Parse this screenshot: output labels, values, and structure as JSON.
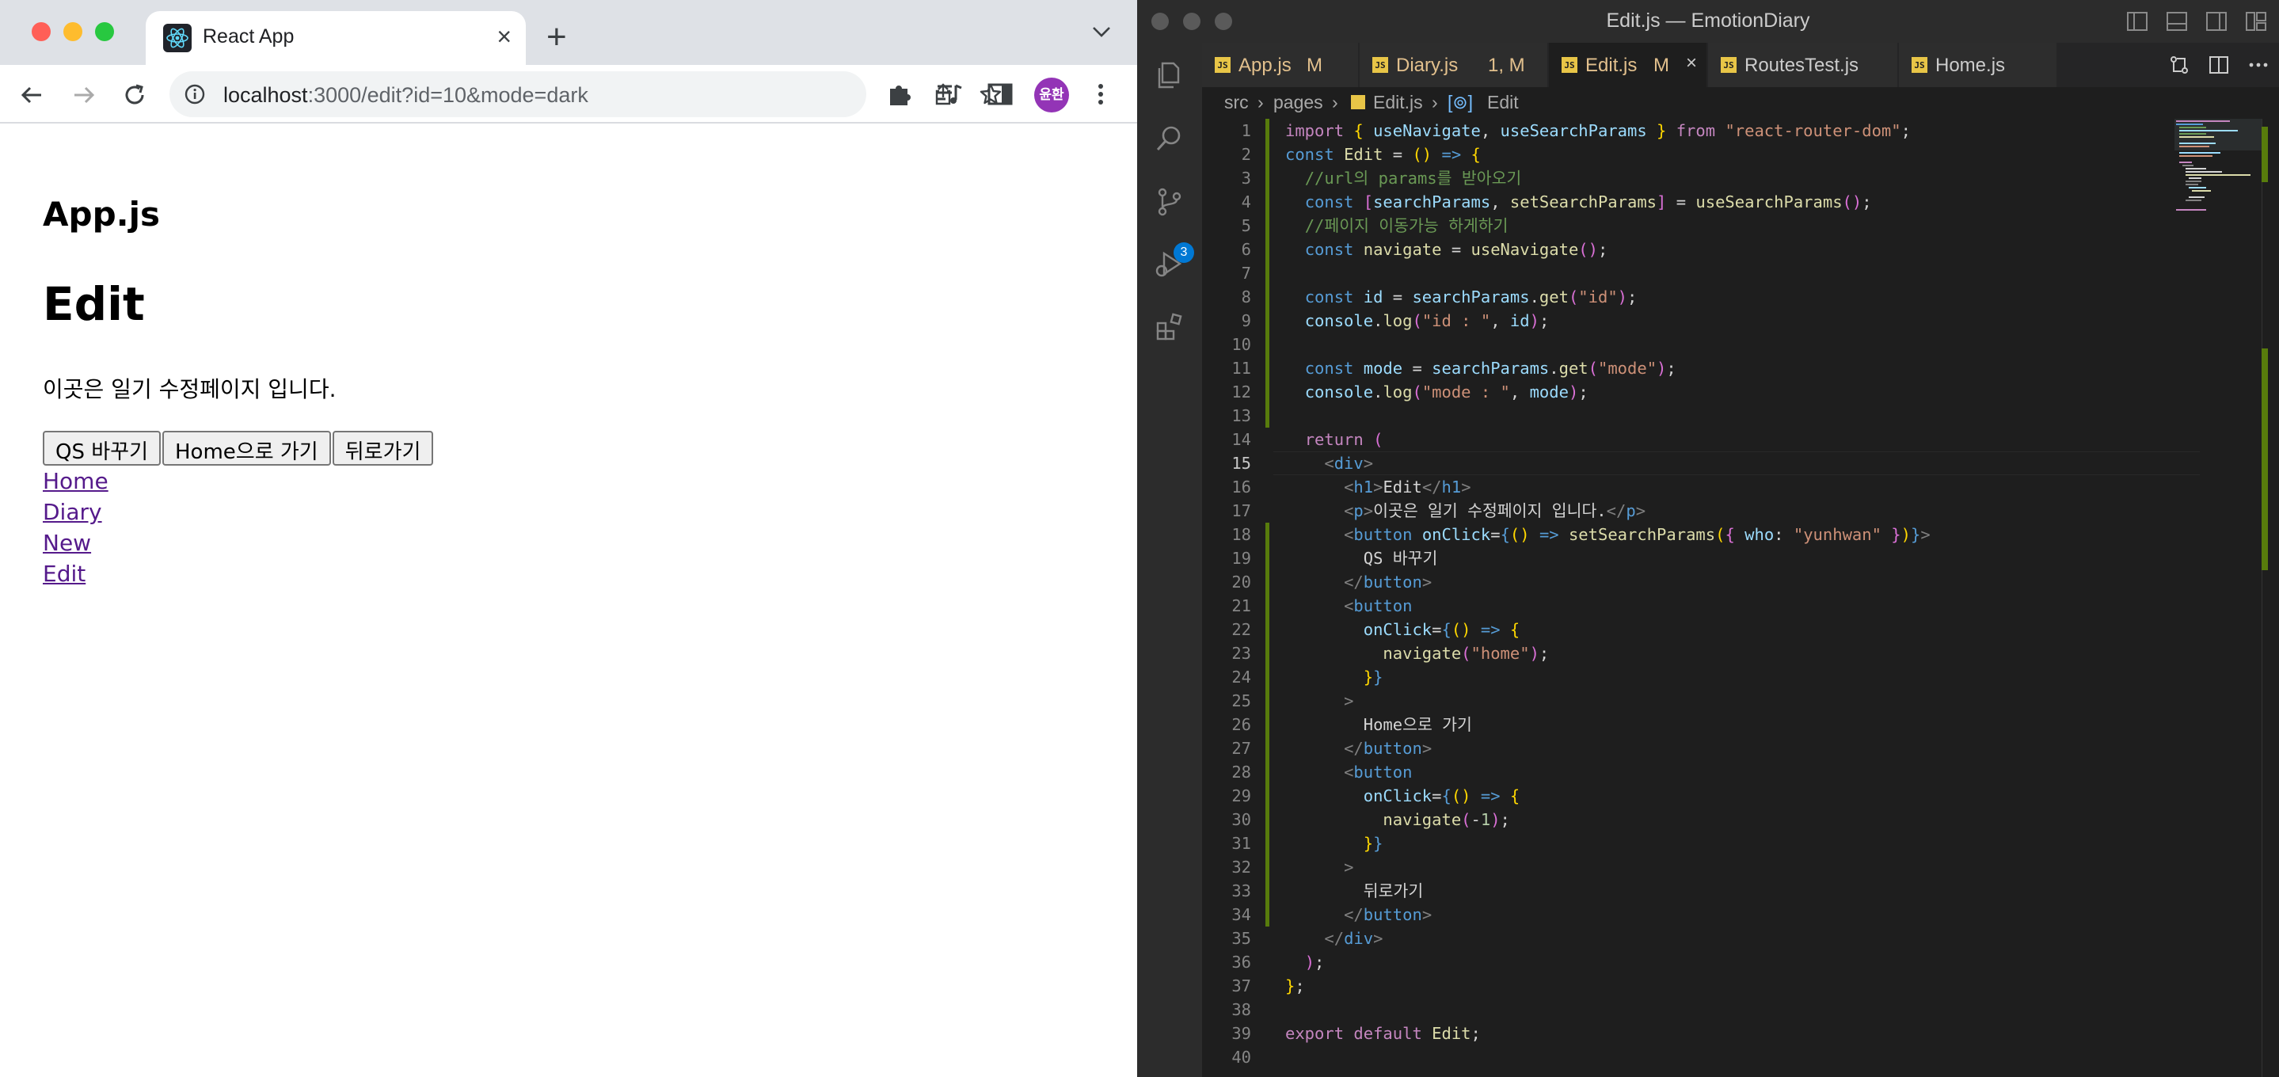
{
  "browser": {
    "tab_title": "React App",
    "url_host": "localhost",
    "url_rest": ":3000/edit?id=10&mode=dark",
    "avatar_text": "윤환",
    "accent_avatar": "#9334b6"
  },
  "page": {
    "app_heading": "App.js",
    "title": "Edit",
    "description": "이곳은 일기 수정페이지 입니다.",
    "buttons": [
      "QS 바꾸기",
      "Home으로 가기",
      "뒤로가기"
    ],
    "links": [
      "Home",
      "Diary",
      "New",
      "Edit"
    ]
  },
  "vscode": {
    "window_title": "Edit.js — EmotionDiary",
    "scm_badge": "3",
    "tabs": [
      {
        "name": "App.js",
        "status": "M"
      },
      {
        "name": "Diary.js",
        "status": "1, M"
      },
      {
        "name": "Edit.js",
        "status": "M"
      },
      {
        "name": "RoutesTest.js",
        "status": ""
      },
      {
        "name": "Home.js",
        "status": ""
      }
    ],
    "breadcrumbs": [
      "src",
      "pages",
      "Edit.js",
      "Edit"
    ],
    "line_numbers": [
      "1",
      "2",
      "3",
      "4",
      "5",
      "6",
      "7",
      "8",
      "9",
      "10",
      "11",
      "12",
      "13",
      "14",
      "15",
      "16",
      "17",
      "18",
      "19",
      "20",
      "21",
      "22",
      "23",
      "24",
      "25",
      "26",
      "27",
      "28",
      "29",
      "30",
      "31",
      "32",
      "33",
      "34",
      "35",
      "36",
      "37",
      "38",
      "39",
      "40"
    ]
  }
}
